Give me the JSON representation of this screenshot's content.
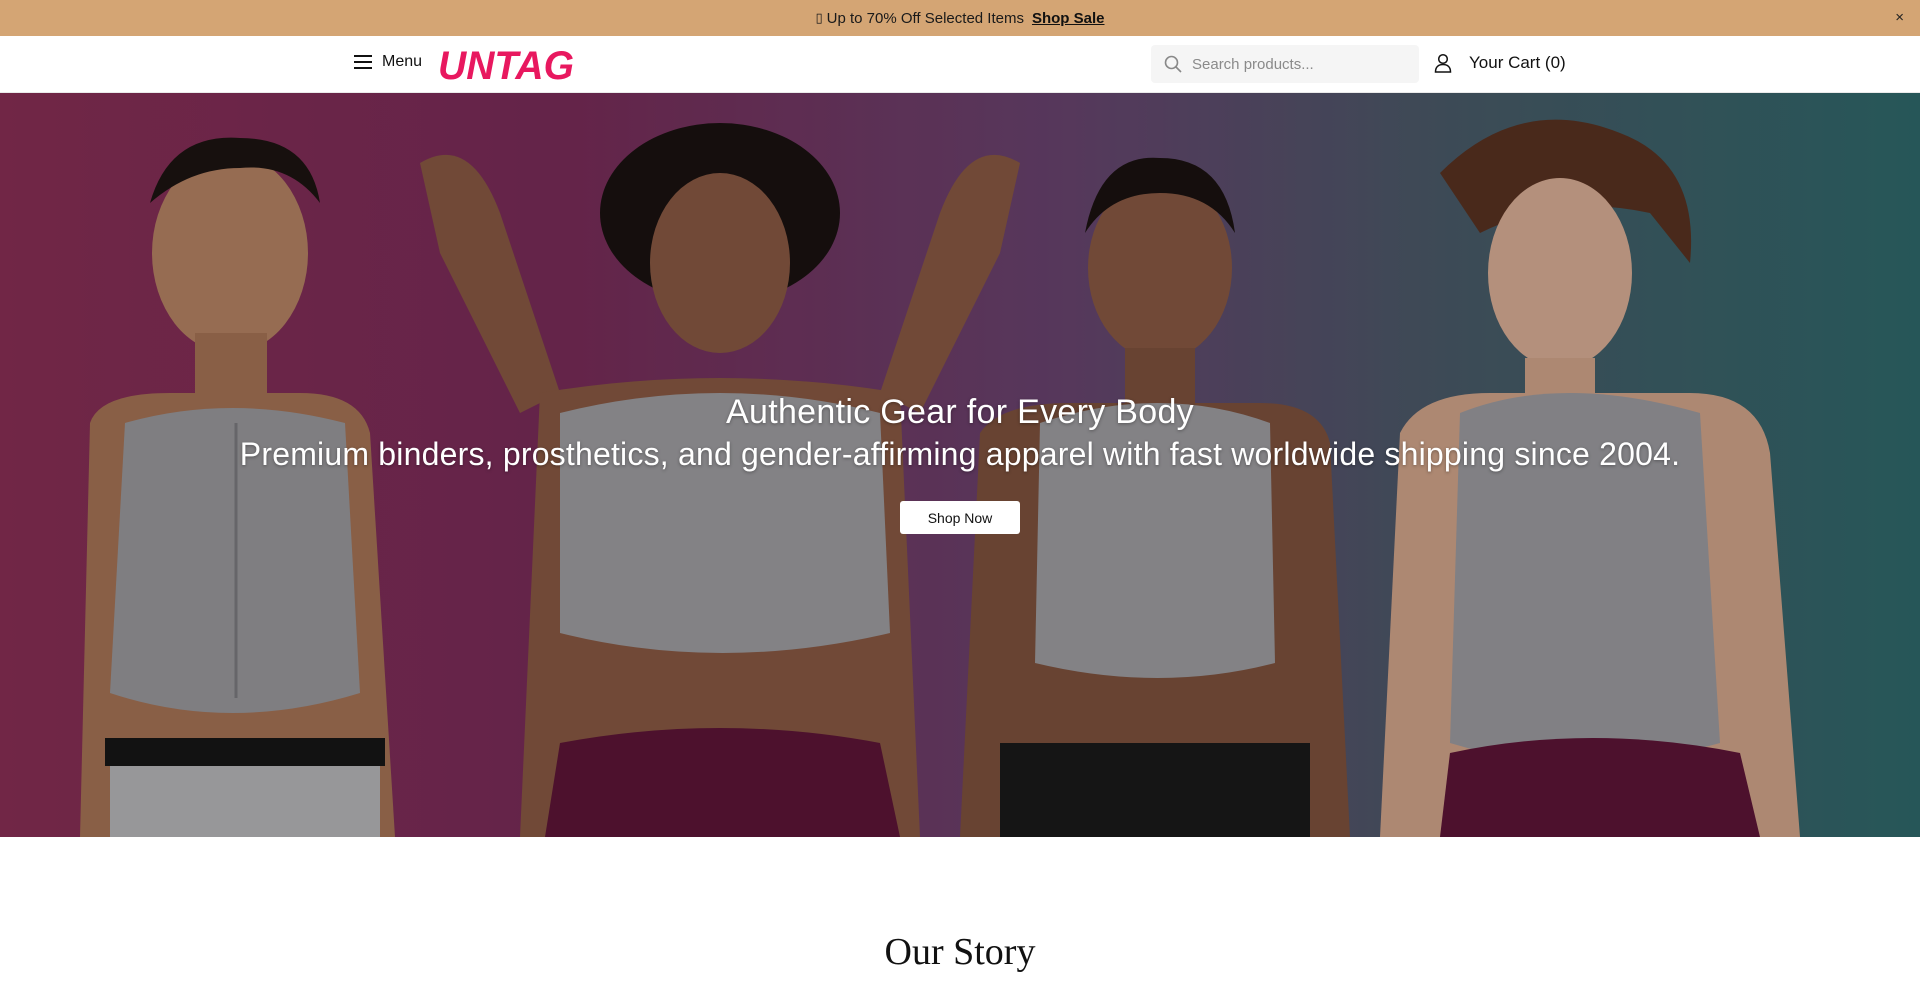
{
  "announcement": {
    "glyph": "▯",
    "promo_text": "Up to 70% Off Selected Items",
    "link_label": "Shop Sale",
    "close_label": "×"
  },
  "header": {
    "menu_label": "Menu",
    "logo_text": "UNTAG",
    "logo_color": "#e8185f",
    "search_placeholder": "Search products...",
    "cart_label": "Your Cart (0)"
  },
  "hero": {
    "title": "Authentic Gear for Every Body",
    "subtitle": "Premium binders, prosthetics, and gender-affirming apparel with fast worldwide shipping since 2004.",
    "cta_label": "Shop Now"
  },
  "story": {
    "title": "Our Story"
  },
  "colors": {
    "announcement_bg": "#d4a574",
    "brand": "#e8185f",
    "hero_left": "#8a2f56",
    "hero_right": "#2f6a6c"
  }
}
